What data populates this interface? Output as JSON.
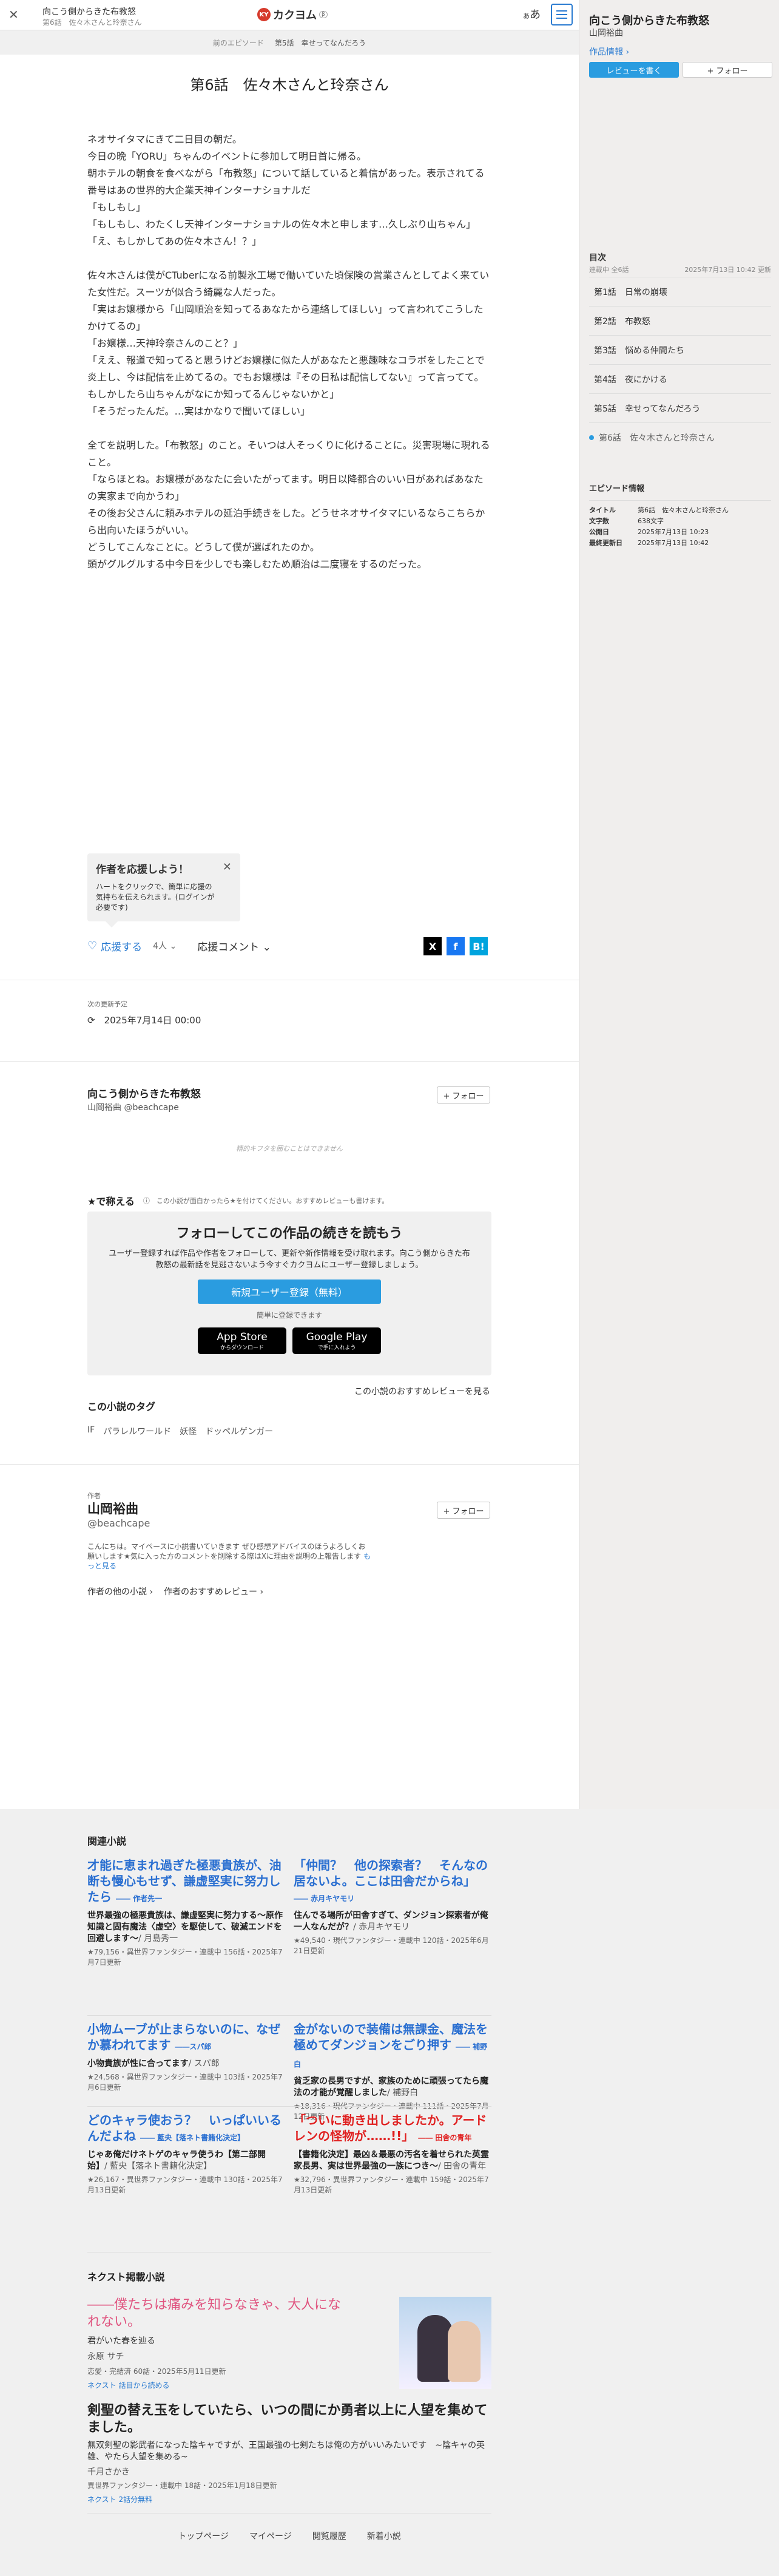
{
  "header": {
    "close": "✕",
    "work_title": "向こう側からきた布教怒",
    "episode_sub": "第6話　佐々木さんと玲奈さん",
    "logo_mark": "KY",
    "logo_name": "カクヨム",
    "logo_ver": "β",
    "font_btn": "あ"
  },
  "episode_nav": {
    "prev": "前のエピソード",
    "current": "第5話　幸せってなんだろう"
  },
  "sidebar": {
    "title": "向こう側からきた布教怒",
    "author": "山岡裕曲",
    "info_link": "作品情報 ›",
    "review_btn": "レビューを書く",
    "follow_btn": "+ フォロー",
    "toc_heading": "目次",
    "toc_status": "連載中 全6話",
    "toc_updated": "2025年7月13日 10:42 更新",
    "toc": [
      "第1話　日常の崩壊",
      "第2話　布教怒",
      "第3話　悩める仲間たち",
      "第4話　夜にかける",
      "第5話　幸せってなんだろう",
      "第6話　佐々木さんと玲奈さん"
    ],
    "episode_info_heading": "エピソード情報",
    "episode_info": [
      {
        "k": "タイトル",
        "v": "第6話　佐々木さんと玲奈さん"
      },
      {
        "k": "文字数",
        "v": "638文字"
      },
      {
        "k": "公開日",
        "v": "2025年7月13日 10:23"
      },
      {
        "k": "最終更新日",
        "v": "2025年7月13日 10:42"
      }
    ]
  },
  "episode_title": "第6話　佐々木さんと玲奈さん",
  "body_paragraphs": [
    "ネオサイタマにきて二日目の朝だ。",
    "今日の晩「YORU」ちゃんのイベントに参加して明日首に帰る。",
    "朝ホテルの朝食を食べながら「布教怒」について話していると着信があった。表示されてる番号はあの世界的大企業天神インターナショナルだ",
    "「もしもし」",
    "「もしもし、わたくし天神インターナショナルの佐々木と申します…久しぶり山ちゃん」",
    "「え、もしかしてあの佐々木さん！？」",
    "",
    "佐々木さんは僕がCTuberになる前製氷工場で働いていた頃保険の営業さんとしてよく来ていた女性だ。スーツが似合う綺麗な人だった。",
    "「実はお嬢様から「山岡順治を知ってるあなたから連絡してほしい」って言われてこうしたかけてるの」",
    "「お嬢様…天神玲奈さんのこと？」",
    "「ええ、報道で知ってると思うけどお嬢様に似た人があなたと悪趣味なコラボをしたことで炎上し、今は配信を止めてるの。でもお嬢様は『その日私は配信してない』って言ってて。もしかしたら山ちゃんがなにか知ってるんじゃないかと」",
    "「そうだったんだ。…実はかなりで聞いてほしい」",
    "",
    "全てを説明した。「布教怒」のこと。そいつは人そっくりに化けることに。災害現場に現れること。",
    "「ならほとね。お嬢様があなたに会いたがってます。明日以降都合のいい日があればあなたの実家まで向かうわ」",
    "その後お父さんに頼みホテルの延泊手続きをした。どうせネオサイタマにいるならこちらから出向いたほうがいい。",
    "どうしてこんなことに。どうして僕が選ばれたのか。",
    "頭がグルグルする中今日を少しでも楽しむため順治は二度寝をするのだった。"
  ],
  "tooltip": {
    "heading": "作者を応援しよう！",
    "body": "ハートをクリックで、簡単に応援の気持ちを伝えられます。(ログインが必要です)",
    "close": "✕"
  },
  "cheer": {
    "heart": "♡",
    "label": "応援する",
    "count": "4人 ⌄",
    "comment": "応援コメント ⌄",
    "share_x": "X",
    "share_fb": "f",
    "share_b": "B!",
    "colors": {
      "x": "#000000",
      "fb": "#1877f2",
      "b": "#00a4de"
    }
  },
  "next_update": {
    "label": "次の更新予定",
    "date": "⟳　2025年7月14日 00:00"
  },
  "work_block": {
    "title": "向こう側からきた布教怒",
    "author": "山岡裕曲 @beachcape",
    "follow": "+ フォロー",
    "no_catch": "精的キフタを囲むことはできません"
  },
  "oshi": {
    "heading": "★で称える",
    "hint": "ⓘ　この小説が面白かったら★を付けてください。おすすめレビューも書けます。"
  },
  "follow_box": {
    "heading": "フォローしてこの作品の続きを読もう",
    "desc": "ユーザー登録すれば作品や作者をフォローして、更新や新作情報を受け取れます。向こう側からきた布教怒の最新話を見逃さないよう今すぐカクヨムにユーザー登録しましょう。",
    "register": "新規ユーザー登録（無料）",
    "easy": "簡単に登録できます",
    "appstore": "App Store",
    "appstore_sub": "からダウンロード",
    "gplay": "Google Play",
    "gplay_sub": "で手に入れよう"
  },
  "review_link": "この小説のおすすめレビューを見る",
  "tags": {
    "heading": "この小説のタグ",
    "items": [
      "IF",
      "パラレルワールド",
      "妖怪",
      "ドッペルゲンガー"
    ]
  },
  "author_block": {
    "label": "作者",
    "name": "山岡裕曲",
    "id": "@beachcape",
    "follow": "+ フォロー",
    "bio": "こんにちは。マイペースに小説書いていきます ぜひ感想アドバイスのほうよろしくお願いします★気に入った方のコメントを削除する際はXに理由を説明の上報告します",
    "more": "もっと見る",
    "link1": "作者の他の小説 ›",
    "link2": "作者のおすすめレビュー ›"
  },
  "related": {
    "heading": "関連小説",
    "items": [
      {
        "catch": "才能に恵まれ過ぎた極悪貴族が、油断も慢心もせず、謙虚堅実に努力したら",
        "by": "―― 作者先一",
        "title": "世界最強の極悪貴族は、謙虚堅実に努力する〜原作知識と固有魔法〈虚空〉を駆使して、破滅エンドを回避します〜",
        "author": "/ 月島秀一",
        "meta": "★79,156・異世界ファンタジー・連載中 156話・2025年7月7日更新",
        "red": false
      },
      {
        "catch": "「仲間？　他の探索者？　そんなの居ないよ。ここは田舎だからね」",
        "by": "―― 赤月キヤモリ",
        "title": "住んでる場所が田舎すぎて、ダンジョン探索者が俺一人なんだが？",
        "author": "/ 赤月キヤモリ",
        "meta": "★49,540・現代ファンタジー・連載中 120話・2025年6月21日更新",
        "red": false
      },
      {
        "catch": "小物ムーブが止まらないのに、なぜか慕われてます",
        "by": "――スパ郎",
        "title": "小物貴族が性に合ってます",
        "author": "/ スパ郎",
        "meta": "★24,568・異世界ファンタジー・連載中 103話・2025年7月6日更新",
        "red": false
      },
      {
        "catch": "金がないので装備は無課金、魔法を極めてダンジョンをごり押す",
        "by": "―― 補野白",
        "title": "貧乏家の長男ですが、家族のために頑張ってたら魔法の才能が覚醒しました",
        "author": "/ 補野白",
        "meta": "★18,316・現代ファンタジー・連載中 111話・2025年7月12日更新",
        "red": false
      },
      {
        "catch": "どのキャラ使おう？　いっぱいいるんだよね",
        "by": "―― 藍央【落ネト書籍化決定】",
        "title": "じゃあ俺だけネトゲのキャラ使うわ【第二部開始】",
        "author": "/ 藍央【落ネト書籍化決定】",
        "meta": "★26,167・異世界ファンタジー・連載中 130話・2025年7月13日更新",
        "red": false
      },
      {
        "catch": "「ついに動き出しましたか。アードレンの怪物が……!!」",
        "by": "―― 田舎の青年",
        "title": "【書籍化決定】最凶＆最悪の汚名を着せられた英霊家長男、実は世界最強の一族につき〜",
        "author": "/ 田舎の青年",
        "meta": "★32,796・異世界ファンタジー・連載中 159話・2025年7月13日更新",
        "red": true
      }
    ]
  },
  "next_novels": {
    "heading": "ネクスト掲載小説",
    "n1": {
      "catch": "――僕たちは痛みを知らなきゃ、大人になれない。",
      "title": "君がいた春を辿る",
      "author": "永原 サチ",
      "meta": "恋愛・完結済 60話・2025年5月11日更新",
      "np": "ネクスト 話目から読める"
    },
    "n2": {
      "catch": "剣聖の替え玉をしていたら、いつの間にか勇者以上に人望を集めてました。",
      "title": "無双剣聖の影武者になった陰キャですが、王国最強の七剣たちは俺の方がいいみたいです　~陰キャの英雄、やたら人望を集める~",
      "author": "千月さかき",
      "meta": "異世界ファンタジー・連載中 18話・2025年1月18日更新",
      "np": "ネクスト 2話分無料"
    }
  },
  "footer": [
    "トップページ",
    "マイページ",
    "閲覧履歴",
    "新着小説"
  ]
}
